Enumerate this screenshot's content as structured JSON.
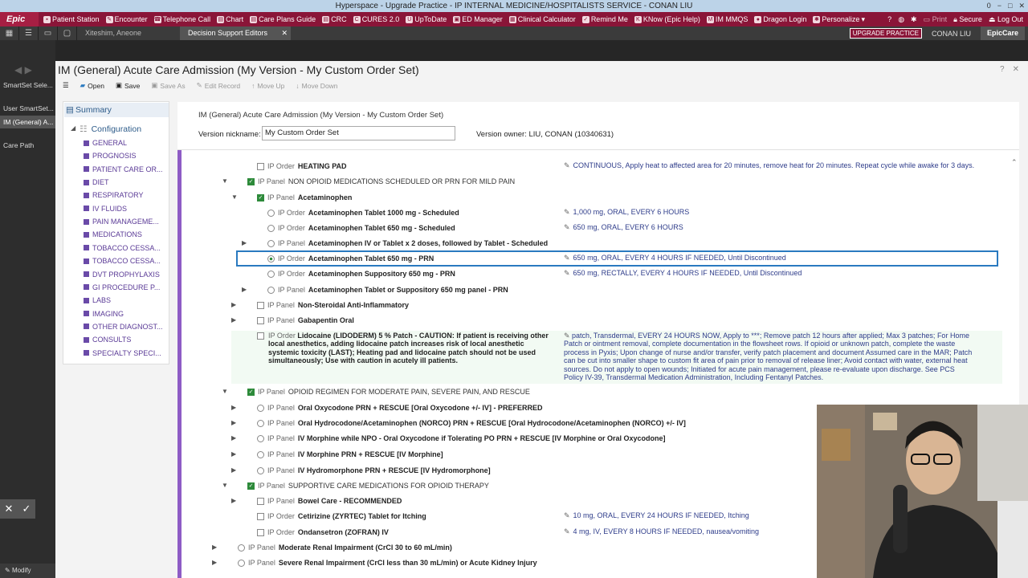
{
  "window": {
    "title": "Hyperspace - Upgrade Practice - IP INTERNAL MEDICINE/HOSPITALISTS  SERVICE - CONAN LIU",
    "controls": [
      "0",
      "−",
      "□",
      "✕"
    ]
  },
  "toolbar": {
    "logo": "Epic",
    "items": [
      "Patient Station",
      "Encounter",
      "Telephone Call",
      "Chart",
      "Care Plans Guide",
      "CRC",
      "CURES 2.0",
      "UpToDate",
      "ED Manager",
      "Clinical Calculator",
      "Remind Me",
      "KNow (Epic Help)",
      "IM MMQS",
      "Dragon Login",
      "Personalize"
    ],
    "right": [
      "Print",
      "Secure",
      "Log Out"
    ]
  },
  "tabs": {
    "patient": "Xiteshim, Aneone",
    "active": "Decision Support Editors",
    "close": "✕",
    "upgrade": "UPGRADE PRACTICE",
    "user": "CONAN LIU",
    "brand": "EpicCare"
  },
  "rail": {
    "items": [
      "SmartSet Sele...",
      "User SmartSet...",
      "IM (General) A...",
      "Care Path"
    ],
    "modify": "Modify"
  },
  "page": {
    "title": "IM (General) Acute Care Admission (My Version - My Custom Order Set)"
  },
  "actions": {
    "open": "Open",
    "save": "Save",
    "save_as": "Save As",
    "edit_record": "Edit Record",
    "move_up": "Move Up",
    "move_down": "Move Down"
  },
  "sidebar": {
    "summary": "Summary",
    "configuration": "Configuration",
    "items": [
      "GENERAL",
      "PROGNOSIS",
      "PATIENT CARE OR...",
      "DIET",
      "RESPIRATORY",
      "IV FLUIDS",
      "PAIN MANAGEME...",
      "MEDICATIONS",
      "TOBACCO CESSA...",
      "TOBACCO CESSA...",
      "DVT PROPHYLAXIS",
      "GI PROCEDURE P...",
      "LABS",
      "IMAGING",
      "OTHER DIAGNOST...",
      "CONSULTS",
      "SPECIALTY SPECI..."
    ]
  },
  "header": {
    "title": "IM (General) Acute Care Admission (My Version - My Custom Order Set)",
    "nickname_label": "Version nickname:",
    "nickname": "My Custom Order Set",
    "owner_label": "Version owner:",
    "owner": "LIU, CONAN (10340631)"
  },
  "orders": [
    {
      "kind": "IP Order",
      "name": "HEATING PAD",
      "ctl": "cb",
      "on": false,
      "details": "CONTINUOUS, Apply heat to affected area for 20 minutes, remove heat for 20 minutes. Repeat cycle while awake for 3 days."
    },
    {
      "kind": "IP Panel",
      "name": "NON OPIOID MEDICATIONS SCHEDULED OR PRN FOR MILD PAIN",
      "ctl": "cb",
      "on": true,
      "details": ""
    },
    {
      "kind": "IP Panel",
      "name": "Acetaminophen",
      "ctl": "cb",
      "on": true,
      "details": ""
    },
    {
      "kind": "IP Order",
      "name": "Acetaminophen Tablet 1000 mg - Scheduled",
      "ctl": "rd",
      "on": false,
      "details": "1,000 mg, ORAL, EVERY 6 HOURS"
    },
    {
      "kind": "IP Order",
      "name": "Acetaminophen Tablet 650 mg - Scheduled",
      "ctl": "rd",
      "on": false,
      "details": "650 mg, ORAL, EVERY 6 HOURS"
    },
    {
      "kind": "IP Panel",
      "name": "Acetaminophen IV or Tablet x 2 doses, followed by Tablet - Scheduled",
      "ctl": "rd",
      "on": false,
      "details": ""
    },
    {
      "kind": "IP Order",
      "name": "Acetaminophen Tablet 650 mg - PRN",
      "ctl": "rd",
      "on": true,
      "details": "650 mg, ORAL, EVERY 4 HOURS IF NEEDED, Until Discontinued"
    },
    {
      "kind": "IP Order",
      "name": "Acetaminophen Suppository 650 mg - PRN",
      "ctl": "rd",
      "on": false,
      "details": "650 mg, RECTALLY, EVERY 4 HOURS IF NEEDED, Until Discontinued"
    },
    {
      "kind": "IP Panel",
      "name": "Acetaminophen Tablet or Suppository 650 mg panel - PRN",
      "ctl": "rd",
      "on": false,
      "details": ""
    },
    {
      "kind": "IP Panel",
      "name": "Non-Steroidal Anti-Inflammatory",
      "ctl": "cb",
      "on": false,
      "details": ""
    },
    {
      "kind": "IP Panel",
      "name": "Gabapentin Oral",
      "ctl": "cb",
      "on": false,
      "details": ""
    },
    {
      "kind": "IP Order",
      "name": "Lidocaine (LIDODERM) 5 % Patch - CAUTION: If patient is receiving other local anesthetics, adding lidocaine patch increases risk of local anesthetic systemic toxicity (LAST); Heating pad and lidocaine patch should not be used simultaneously; Use with caution in acutely ill patients.",
      "ctl": "cb",
      "on": false,
      "details": "patch, Transdermal, EVERY 24 HOURS NOW, Apply to ***; Remove patch 12 hours after applied; Max 3 patches; For Home Patch or ointment removal, complete documentation in the flowsheet rows. If opioid or unknown patch, complete the waste process in Pyxis; Upon change of nurse and/or transfer, verify patch placement and document Assumed care in the MAR; Patch can be cut into smaller shape to custom fit area of pain prior to removal of release liner; Avoid contact with water, external heat sources. Do not apply to open wounds; Initiated for acute pain management, please re-evaluate upon discharge. See PCS Policy IV-39, Transdermal Medication Administration, Including Fentanyl Patches."
    },
    {
      "kind": "IP Panel",
      "name": "OPIOID REGIMEN FOR MODERATE PAIN, SEVERE PAIN, AND RESCUE",
      "ctl": "cb",
      "on": true,
      "details": ""
    },
    {
      "kind": "IP Panel",
      "name": "Oral Oxycodone PRN + RESCUE [Oral Oxycodone +/- IV] - PREFERRED",
      "ctl": "rd",
      "on": false,
      "details": ""
    },
    {
      "kind": "IP Panel",
      "name": "Oral Hydrocodone/Acetaminophen (NORCO) PRN + RESCUE [Oral Hydrocodone/Acetaminophen (NORCO) +/- IV]",
      "ctl": "rd",
      "on": false,
      "details": ""
    },
    {
      "kind": "IP Panel",
      "name": "IV Morphine while NPO - Oral Oxycodone if Tolerating PO PRN + RESCUE [IV Morphine or Oral Oxycodone]",
      "ctl": "rd",
      "on": false,
      "details": ""
    },
    {
      "kind": "IP Panel",
      "name": "IV Morphine PRN + RESCUE [IV Morphine]",
      "ctl": "rd",
      "on": false,
      "details": ""
    },
    {
      "kind": "IP Panel",
      "name": "IV Hydromorphone PRN + RESCUE [IV Hydromorphone]",
      "ctl": "rd",
      "on": false,
      "details": ""
    },
    {
      "kind": "IP Panel",
      "name": "SUPPORTIVE CARE MEDICATIONS FOR OPIOID THERAPY",
      "ctl": "cb",
      "on": true,
      "details": ""
    },
    {
      "kind": "IP Panel",
      "name": "Bowel Care - RECOMMENDED",
      "ctl": "cb",
      "on": false,
      "details": ""
    },
    {
      "kind": "IP Order",
      "name": "Cetirizine (ZYRTEC) Tablet for Itching",
      "ctl": "cb",
      "on": false,
      "details": "10 mg, ORAL, EVERY 24 HOURS IF NEEDED, Itching"
    },
    {
      "kind": "IP Order",
      "name": "Ondansetron (ZOFRAN) IV",
      "ctl": "cb",
      "on": false,
      "details": "4 mg, IV, EVERY 8 HOURS IF NEEDED, nausea/vomiting"
    },
    {
      "kind": "IP Panel",
      "name": "Moderate Renal Impairment (CrCl 30 to 60 mL/min)",
      "ctl": "rd",
      "on": false,
      "details": ""
    },
    {
      "kind": "IP Panel",
      "name": "Severe Renal Impairment (CrCl less than 30 mL/min) or Acute Kidney Injury",
      "ctl": "rd",
      "on": false,
      "details": ""
    }
  ]
}
